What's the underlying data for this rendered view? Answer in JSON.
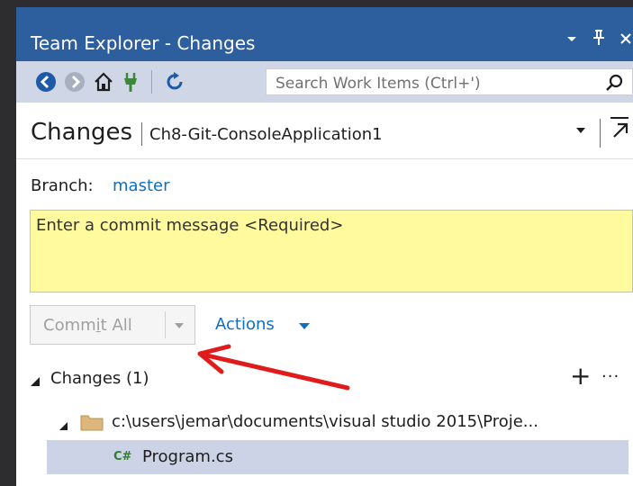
{
  "window": {
    "title": "Team Explorer - Changes"
  },
  "toolbar": {
    "search_placeholder": "Search Work Items (Ctrl+')"
  },
  "header": {
    "page": "Changes",
    "project": "Ch8-Git-ConsoleApplication1"
  },
  "branch": {
    "label": "Branch:",
    "name": "master"
  },
  "commit": {
    "placeholder": "Enter a commit message <Required>",
    "button_pre": "Comm",
    "button_ul": "i",
    "button_post": "t All",
    "actions_label": "Actions"
  },
  "changes": {
    "section_title": "Changes (1)",
    "add_symbol": "+",
    "more_symbol": "···",
    "folder_path": "c:\\users\\jemar\\documents\\visual studio 2015\\Proje...",
    "file_icon": "C#",
    "file_name": "Program.cs"
  },
  "colors": {
    "title_bar": "#2d5f9e",
    "link": "#0e70c0",
    "commit_box": "#fffa9e",
    "selected_row": "#cdd3e6",
    "annotation_arrow": "#e01b1b"
  }
}
